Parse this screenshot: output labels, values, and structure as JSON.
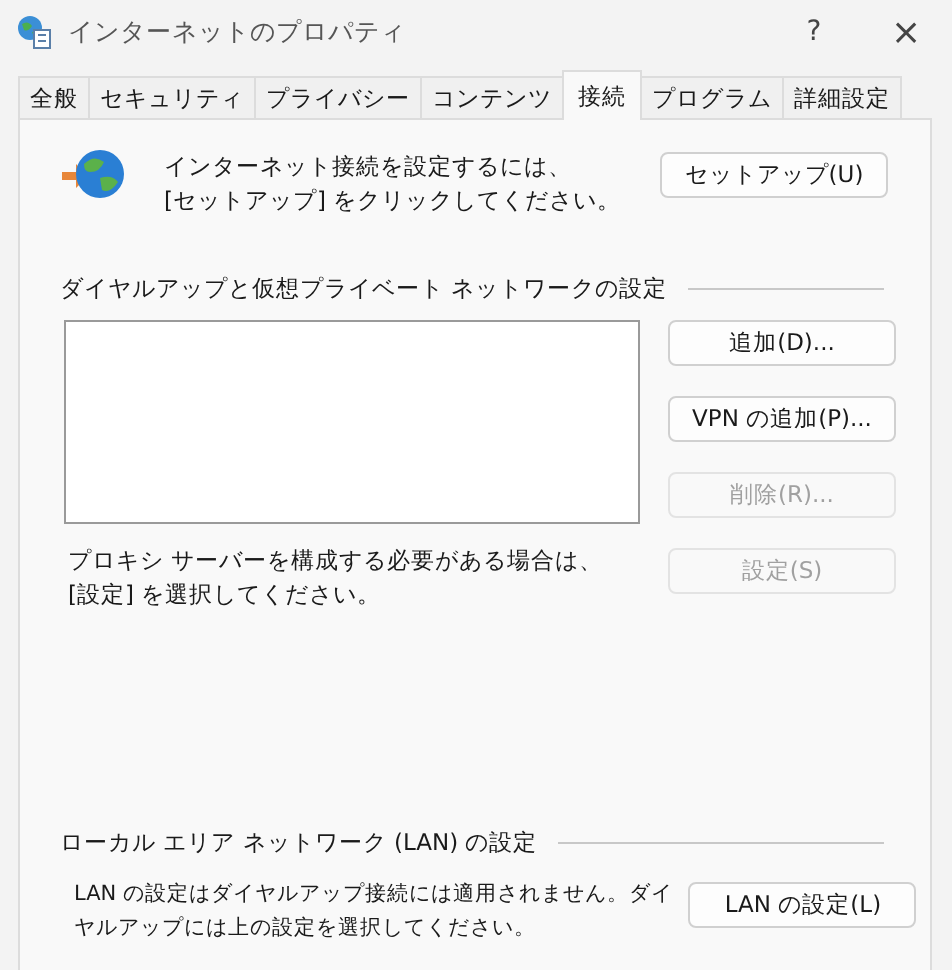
{
  "window": {
    "title": "インターネットのプロパティ",
    "help": "?",
    "close": "×"
  },
  "tabs": [
    {
      "label": "全般",
      "selected": false
    },
    {
      "label": "セキュリティ",
      "selected": false
    },
    {
      "label": "プライバシー",
      "selected": false
    },
    {
      "label": "コンテンツ",
      "selected": false
    },
    {
      "label": "接続",
      "selected": true
    },
    {
      "label": "プログラム",
      "selected": false
    },
    {
      "label": "詳細設定",
      "selected": false
    }
  ],
  "setup": {
    "text_lines": [
      "インターネット接続を設定するには、",
      "[セットアップ] をクリックしてください。"
    ],
    "button": {
      "label": "セットアップ(U)",
      "disabled": false
    }
  },
  "dialup": {
    "heading": "ダイヤルアップと仮想プライベート ネットワークの設定",
    "buttons": [
      {
        "label": "追加(D)...",
        "disabled": false
      },
      {
        "label": "VPN の追加(P)...",
        "disabled": false
      },
      {
        "label": "削除(R)...",
        "disabled": true
      },
      {
        "label": "設定(S)",
        "disabled": true
      }
    ],
    "proxy_lines": [
      "プロキシ サーバーを構成する必要がある場合は、",
      "[設定] を選択してください。"
    ]
  },
  "lan": {
    "heading": "ローカル エリア ネットワーク (LAN) の設定",
    "text_lines": [
      "LAN の設定はダイヤルアップ接続には適用されません。ダイ",
      "ヤルアップには上の設定を選択してください。"
    ],
    "button": {
      "label": "LAN の設定(L)",
      "disabled": false
    }
  }
}
